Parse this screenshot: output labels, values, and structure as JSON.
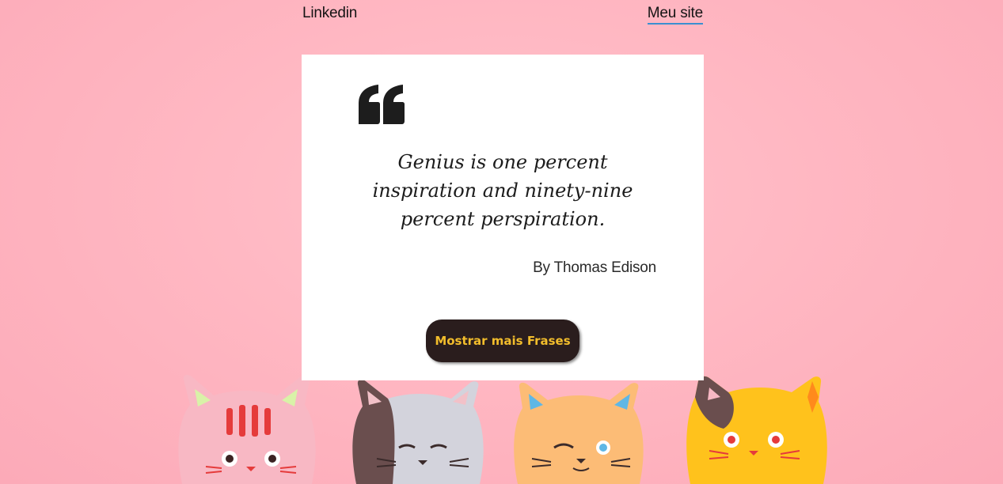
{
  "nav": {
    "linkedin_label": "Linkedin",
    "site_label": "Meu site"
  },
  "quote": {
    "text": "Genius is one percent inspiration and ninety-nine percent perspiration.",
    "author": "By Thomas Edison"
  },
  "actions": {
    "more_label": "Mostrar mais Frases"
  },
  "icons": {
    "quote": "quote-mark-icon"
  },
  "colors": {
    "background": "#ffb7c2",
    "card": "#ffffff",
    "button_bg": "#2a1d1d",
    "button_text": "#f2bd2c",
    "link_underline": "#3a8fd0"
  }
}
